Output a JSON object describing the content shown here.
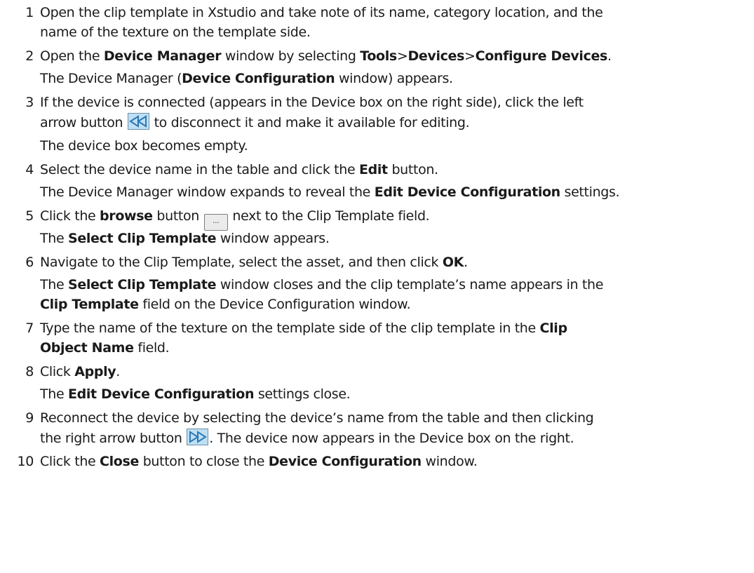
{
  "steps": [
    {
      "n": "1",
      "l1": "Open the clip template in Xstudio and take note of its name, category location, and the",
      "l2": "name of the texture on the template side."
    },
    {
      "n": "2",
      "a": "Open the ",
      "b": "Device Manager",
      "c": " window by selecting ",
      "d": "Tools",
      "e": ">",
      "f": "Devices",
      "g": ">",
      "h": "Configure Devices",
      "i": ".",
      "r_a": "The Device Manager (",
      "r_b": "Device Configuration",
      "r_c": " window) appears."
    },
    {
      "n": "3",
      "l1": "If the device is connected (appears in the Device box on the right side), click the left",
      "l2a": "arrow button ",
      "l2b": " to disconnect it and make it available for editing.",
      "r": "The device box becomes empty."
    },
    {
      "n": "4",
      "a": "Select the device name in the table and click the ",
      "b": "Edit",
      "c": " button.",
      "r_a": "The Device Manager window expands to reveal the ",
      "r_b": "Edit Device Configuration",
      "r_c": " settings."
    },
    {
      "n": "5",
      "a": "Click the ",
      "b": "browse",
      "c": " button ",
      "d": " next to the Clip Template field.",
      "r_a": "The ",
      "r_b": "Select Clip Template",
      "r_c": " window appears."
    },
    {
      "n": "6",
      "a": "Navigate to the Clip Template, select the asset, and then click ",
      "b": "OK",
      "c": ".",
      "r1_a": "The ",
      "r1_b": "Select Clip Template",
      "r1_c": " window closes and the clip template’s name appears in the",
      "r2_a": "Clip Template",
      "r2_b": " field on the Device Configuration window."
    },
    {
      "n": "7",
      "a": "Type the name of the texture on the template side of the clip template in the ",
      "b": "Clip",
      "l2a": "Object Name",
      "l2b": " field."
    },
    {
      "n": "8",
      "a": "Click ",
      "b": "Apply",
      "c": ".",
      "r_a": "The ",
      "r_b": "Edit Device Configuration",
      "r_c": " settings close."
    },
    {
      "n": "9",
      "l1": "Reconnect the device by selecting the device’s name from the table and then clicking",
      "l2a": "the right arrow button ",
      "l2b": ". The device now appears in the Device box on the right."
    },
    {
      "n": "10",
      "a": "Click the ",
      "b": "Close",
      "c": " button to close the ",
      "d": "Device Configuration",
      "e": " window."
    }
  ],
  "icons": {
    "back": "rewind-arrow-icon",
    "browse": "browse-ellipsis-icon",
    "browse_text": "...",
    "fwd": "forward-arrow-icon",
    "arrow_color": "#2f78b4"
  }
}
